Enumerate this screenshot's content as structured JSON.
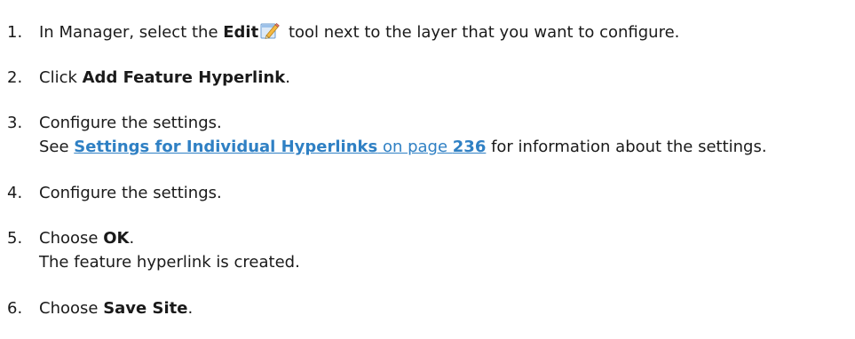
{
  "steps": [
    {
      "number": "1.",
      "prefix": "In Manager, select the ",
      "bold": "Edit",
      "icon": "edit-pencil-icon",
      "suffix": " tool next to the layer that you want to configure."
    },
    {
      "number": "2.",
      "prefix": "Click ",
      "bold": "Add Feature Hyperlink",
      "suffix": "."
    },
    {
      "number": "3.",
      "text": "Configure the settings.",
      "note_prefix": "See ",
      "link_title": "Settings for Individual Hyperlinks",
      "link_mid": " on page ",
      "link_page": "236",
      "note_suffix": " for information about the settings."
    },
    {
      "number": "4.",
      "text": "Configure the settings."
    },
    {
      "number": "5.",
      "prefix": "Choose ",
      "bold": "OK",
      "suffix": ".",
      "note": "The feature hyperlink is created."
    },
    {
      "number": "6.",
      "prefix": "Choose ",
      "bold": "Save Site",
      "suffix": "."
    }
  ],
  "colors": {
    "text": "#1a1a1a",
    "link": "#2f80c4"
  }
}
